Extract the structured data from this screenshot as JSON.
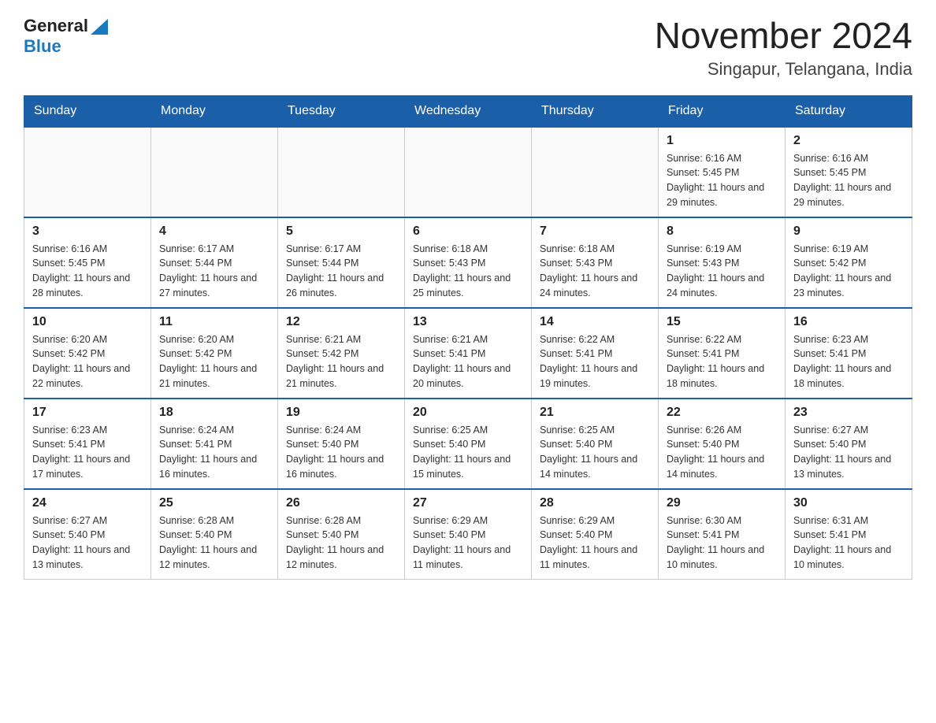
{
  "header": {
    "logo_general": "General",
    "logo_blue": "Blue",
    "main_title": "November 2024",
    "subtitle": "Singapur, Telangana, India"
  },
  "days_of_week": [
    "Sunday",
    "Monday",
    "Tuesday",
    "Wednesday",
    "Thursday",
    "Friday",
    "Saturday"
  ],
  "weeks": [
    [
      {
        "day": "",
        "info": ""
      },
      {
        "day": "",
        "info": ""
      },
      {
        "day": "",
        "info": ""
      },
      {
        "day": "",
        "info": ""
      },
      {
        "day": "",
        "info": ""
      },
      {
        "day": "1",
        "info": "Sunrise: 6:16 AM\nSunset: 5:45 PM\nDaylight: 11 hours and 29 minutes."
      },
      {
        "day": "2",
        "info": "Sunrise: 6:16 AM\nSunset: 5:45 PM\nDaylight: 11 hours and 29 minutes."
      }
    ],
    [
      {
        "day": "3",
        "info": "Sunrise: 6:16 AM\nSunset: 5:45 PM\nDaylight: 11 hours and 28 minutes."
      },
      {
        "day": "4",
        "info": "Sunrise: 6:17 AM\nSunset: 5:44 PM\nDaylight: 11 hours and 27 minutes."
      },
      {
        "day": "5",
        "info": "Sunrise: 6:17 AM\nSunset: 5:44 PM\nDaylight: 11 hours and 26 minutes."
      },
      {
        "day": "6",
        "info": "Sunrise: 6:18 AM\nSunset: 5:43 PM\nDaylight: 11 hours and 25 minutes."
      },
      {
        "day": "7",
        "info": "Sunrise: 6:18 AM\nSunset: 5:43 PM\nDaylight: 11 hours and 24 minutes."
      },
      {
        "day": "8",
        "info": "Sunrise: 6:19 AM\nSunset: 5:43 PM\nDaylight: 11 hours and 24 minutes."
      },
      {
        "day": "9",
        "info": "Sunrise: 6:19 AM\nSunset: 5:42 PM\nDaylight: 11 hours and 23 minutes."
      }
    ],
    [
      {
        "day": "10",
        "info": "Sunrise: 6:20 AM\nSunset: 5:42 PM\nDaylight: 11 hours and 22 minutes."
      },
      {
        "day": "11",
        "info": "Sunrise: 6:20 AM\nSunset: 5:42 PM\nDaylight: 11 hours and 21 minutes."
      },
      {
        "day": "12",
        "info": "Sunrise: 6:21 AM\nSunset: 5:42 PM\nDaylight: 11 hours and 21 minutes."
      },
      {
        "day": "13",
        "info": "Sunrise: 6:21 AM\nSunset: 5:41 PM\nDaylight: 11 hours and 20 minutes."
      },
      {
        "day": "14",
        "info": "Sunrise: 6:22 AM\nSunset: 5:41 PM\nDaylight: 11 hours and 19 minutes."
      },
      {
        "day": "15",
        "info": "Sunrise: 6:22 AM\nSunset: 5:41 PM\nDaylight: 11 hours and 18 minutes."
      },
      {
        "day": "16",
        "info": "Sunrise: 6:23 AM\nSunset: 5:41 PM\nDaylight: 11 hours and 18 minutes."
      }
    ],
    [
      {
        "day": "17",
        "info": "Sunrise: 6:23 AM\nSunset: 5:41 PM\nDaylight: 11 hours and 17 minutes."
      },
      {
        "day": "18",
        "info": "Sunrise: 6:24 AM\nSunset: 5:41 PM\nDaylight: 11 hours and 16 minutes."
      },
      {
        "day": "19",
        "info": "Sunrise: 6:24 AM\nSunset: 5:40 PM\nDaylight: 11 hours and 16 minutes."
      },
      {
        "day": "20",
        "info": "Sunrise: 6:25 AM\nSunset: 5:40 PM\nDaylight: 11 hours and 15 minutes."
      },
      {
        "day": "21",
        "info": "Sunrise: 6:25 AM\nSunset: 5:40 PM\nDaylight: 11 hours and 14 minutes."
      },
      {
        "day": "22",
        "info": "Sunrise: 6:26 AM\nSunset: 5:40 PM\nDaylight: 11 hours and 14 minutes."
      },
      {
        "day": "23",
        "info": "Sunrise: 6:27 AM\nSunset: 5:40 PM\nDaylight: 11 hours and 13 minutes."
      }
    ],
    [
      {
        "day": "24",
        "info": "Sunrise: 6:27 AM\nSunset: 5:40 PM\nDaylight: 11 hours and 13 minutes."
      },
      {
        "day": "25",
        "info": "Sunrise: 6:28 AM\nSunset: 5:40 PM\nDaylight: 11 hours and 12 minutes."
      },
      {
        "day": "26",
        "info": "Sunrise: 6:28 AM\nSunset: 5:40 PM\nDaylight: 11 hours and 12 minutes."
      },
      {
        "day": "27",
        "info": "Sunrise: 6:29 AM\nSunset: 5:40 PM\nDaylight: 11 hours and 11 minutes."
      },
      {
        "day": "28",
        "info": "Sunrise: 6:29 AM\nSunset: 5:40 PM\nDaylight: 11 hours and 11 minutes."
      },
      {
        "day": "29",
        "info": "Sunrise: 6:30 AM\nSunset: 5:41 PM\nDaylight: 11 hours and 10 minutes."
      },
      {
        "day": "30",
        "info": "Sunrise: 6:31 AM\nSunset: 5:41 PM\nDaylight: 11 hours and 10 minutes."
      }
    ]
  ]
}
